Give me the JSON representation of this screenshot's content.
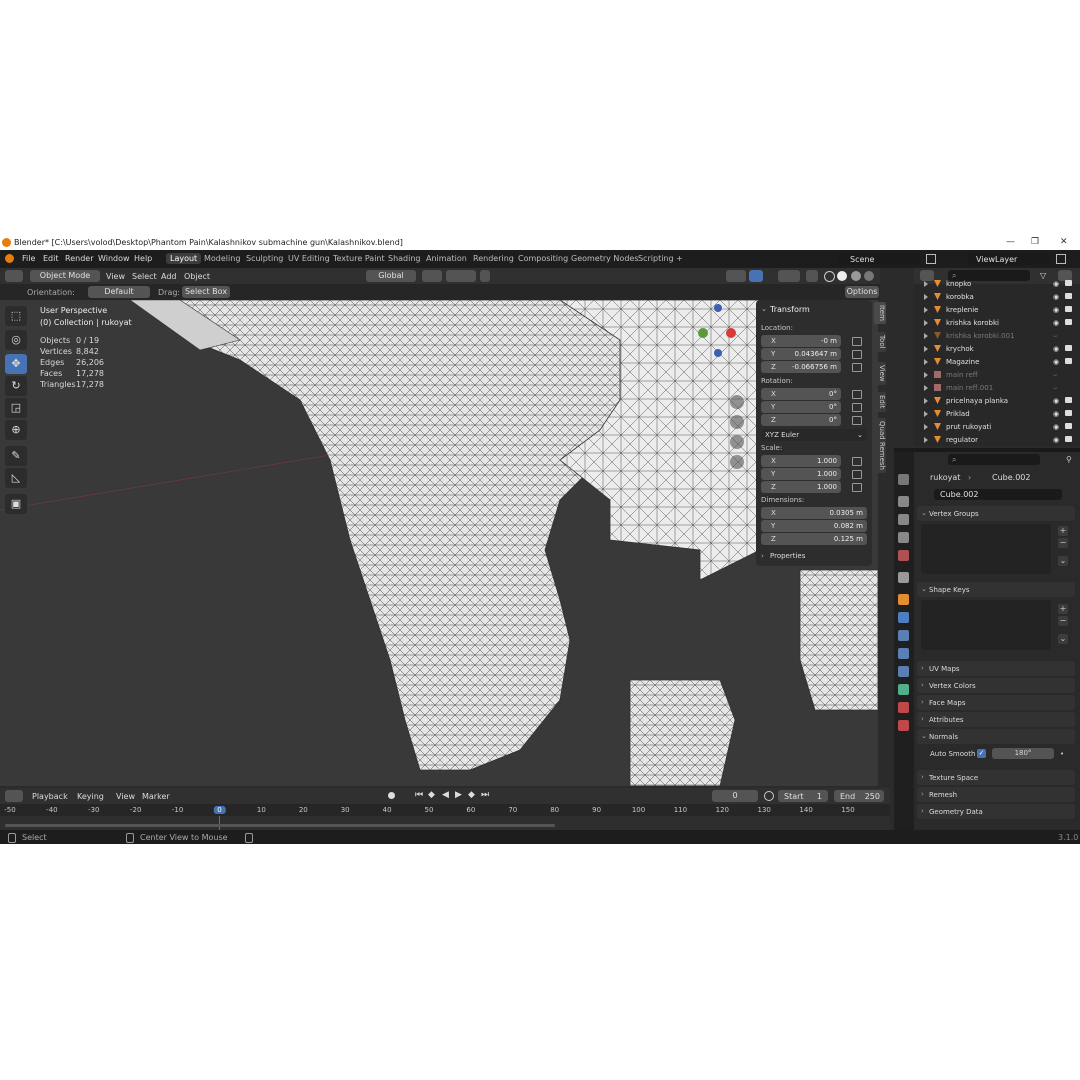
{
  "window": {
    "title": "Blender* [C:\\Users\\volod\\Desktop\\Phantom Pain\\Kalashnikov submachine gun\\Kalashnikov.blend]",
    "controls": [
      "—",
      "❐",
      "✕"
    ]
  },
  "menubar": {
    "items": [
      "File",
      "Edit",
      "Render",
      "Window",
      "Help"
    ],
    "workspaces": [
      "Layout",
      "Modeling",
      "Sculpting",
      "UV Editing",
      "Texture Paint",
      "Shading",
      "Animation",
      "Rendering",
      "Compositing",
      "Geometry Nodes",
      "Scripting",
      "+"
    ],
    "active_workspace": "Layout",
    "scene": "Scene",
    "view_layer": "ViewLayer"
  },
  "header": {
    "mode": "Object Mode",
    "menus": [
      "View",
      "Select",
      "Add",
      "Object"
    ],
    "transform_orientation": "Global",
    "options": "Options"
  },
  "subheader": {
    "orientation_label": "Orientation:",
    "orientation_value": "Default",
    "drag_label": "Drag:",
    "drag_value": "Select Box"
  },
  "viewport": {
    "perspective": "User Perspective",
    "collection": "(0) Collection | rukoyat",
    "stats": [
      {
        "label": "Objects",
        "value": "0 / 19"
      },
      {
        "label": "Vertices",
        "value": "8,842"
      },
      {
        "label": "Edges",
        "value": "26,206"
      },
      {
        "label": "Faces",
        "value": "17,278"
      },
      {
        "label": "Triangles",
        "value": "17,278"
      }
    ],
    "tools": [
      "select-box-icon",
      "cursor-icon",
      "move-icon",
      "rotate-icon",
      "scale-icon",
      "transform-icon",
      "annotate-icon",
      "measure-icon",
      "add-cube-icon"
    ]
  },
  "npanel": {
    "header": "Transform",
    "location_label": "Location:",
    "location": [
      {
        "k": "X",
        "v": "-0 m"
      },
      {
        "k": "Y",
        "v": "0.043647 m"
      },
      {
        "k": "Z",
        "v": "-0.066756 m"
      }
    ],
    "rotation_label": "Rotation:",
    "rotation": [
      {
        "k": "X",
        "v": "0°"
      },
      {
        "k": "Y",
        "v": "0°"
      },
      {
        "k": "Z",
        "v": "0°"
      }
    ],
    "rotation_mode": "XYZ Euler",
    "scale_label": "Scale:",
    "scale": [
      {
        "k": "X",
        "v": "1.000"
      },
      {
        "k": "Y",
        "v": "1.000"
      },
      {
        "k": "Z",
        "v": "1.000"
      }
    ],
    "dimensions_label": "Dimensions:",
    "dimensions": [
      {
        "k": "X",
        "v": "0.0305 m"
      },
      {
        "k": "Y",
        "v": "0.082 m"
      },
      {
        "k": "Z",
        "v": "0.125 m"
      }
    ],
    "properties": "Properties",
    "tabs": [
      "Item",
      "Tool",
      "View",
      "Edit",
      "Quad Remesh"
    ]
  },
  "outliner": {
    "items": [
      {
        "name": "knopko",
        "dim": false
      },
      {
        "name": "korobka",
        "dim": false
      },
      {
        "name": "kreplenie",
        "dim": false
      },
      {
        "name": "krishka korobki",
        "dim": false
      },
      {
        "name": "krishka korobki.001",
        "dim": true
      },
      {
        "name": "krychok",
        "dim": false
      },
      {
        "name": "Magazine",
        "dim": false
      },
      {
        "name": "main reff",
        "dim": true
      },
      {
        "name": "main reff.001",
        "dim": true
      },
      {
        "name": "pricelnaya planka",
        "dim": false
      },
      {
        "name": "Priklad",
        "dim": false
      },
      {
        "name": "prut rukoyati",
        "dim": false
      },
      {
        "name": "regulator",
        "dim": false
      }
    ]
  },
  "properties": {
    "object": "rukoyat",
    "mesh": "Cube.002",
    "mesh_field": "Cube.002",
    "sections": [
      "Vertex Groups",
      "Shape Keys",
      "UV Maps",
      "Vertex Colors",
      "Face Maps",
      "Attributes",
      "Normals",
      "Texture Space",
      "Remesh",
      "Geometry Data"
    ],
    "auto_smooth_label": "Auto Smooth",
    "auto_smooth_angle": "180°"
  },
  "timeline": {
    "menus": [
      "Playback",
      "Keying",
      "View",
      "Marker"
    ],
    "current_frame": "0",
    "start_label": "Start",
    "start": "1",
    "end_label": "End",
    "end": "250",
    "ticks": [
      "-50",
      "-40",
      "-30",
      "-20",
      "-10",
      "0",
      "10",
      "20",
      "30",
      "40",
      "50",
      "60",
      "70",
      "80",
      "90",
      "100",
      "110",
      "120",
      "130",
      "140",
      "150"
    ]
  },
  "status": {
    "left": "Select",
    "middle": "Center View to Mouse",
    "version": "3.1.0"
  },
  "colors": {
    "accent": "#4772b3",
    "mesh_fill": "#ececec",
    "background": "#393939"
  }
}
